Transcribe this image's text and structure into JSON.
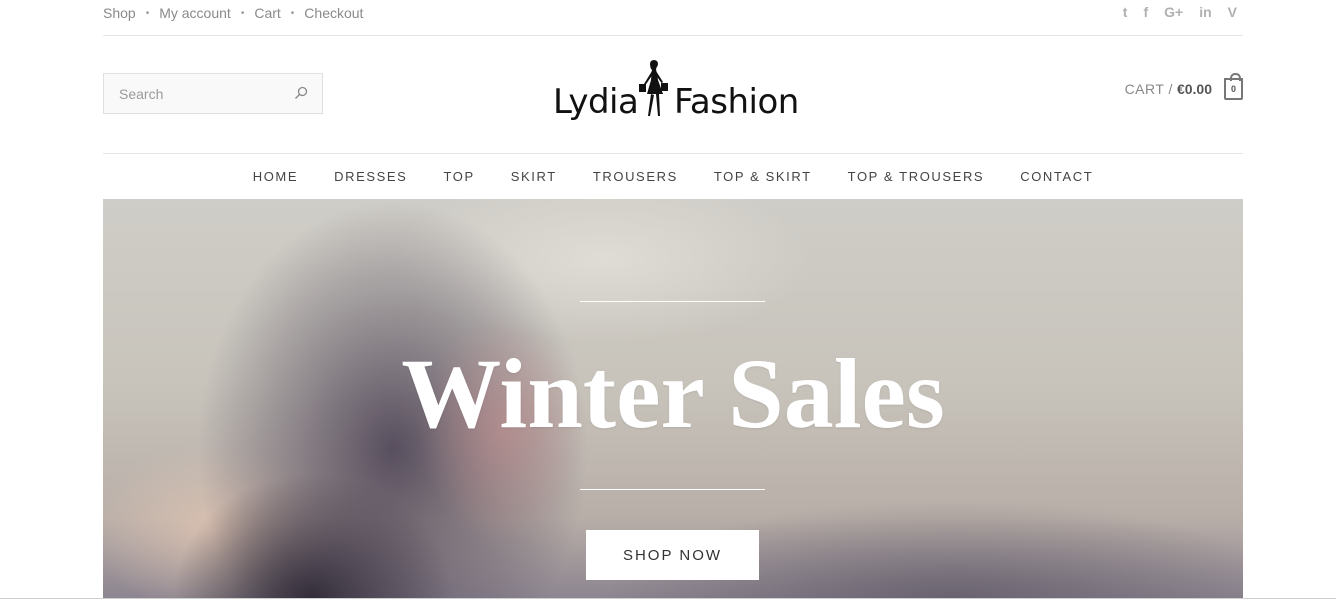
{
  "topbar": {
    "links": [
      "Shop",
      "My account",
      "Cart",
      "Checkout"
    ],
    "social_icons": [
      "twitter-icon",
      "facebook-icon",
      "google-plus-icon",
      "linkedin-icon",
      "vimeo-icon"
    ],
    "social_glyphs": [
      "t",
      "f",
      "G+",
      "in",
      "V"
    ]
  },
  "header": {
    "search_placeholder": "Search",
    "logo": {
      "word1": "Lydia",
      "word2": "Fashion"
    },
    "cart": {
      "label": "CART /",
      "amount": "€0.00",
      "count": "0"
    }
  },
  "nav": {
    "items": [
      "HOME",
      "DRESSES",
      "TOP",
      "SKIRT",
      "TROUSERS",
      "TOP & SKIRT",
      "TOP & TROUSERS",
      "CONTACT"
    ]
  },
  "hero": {
    "title": "Winter Sales",
    "button_label": "SHOP NOW"
  },
  "colors": {
    "nav_text": "#444444",
    "topbar_text": "#8a8a8a",
    "hero_text": "#ffffff"
  }
}
